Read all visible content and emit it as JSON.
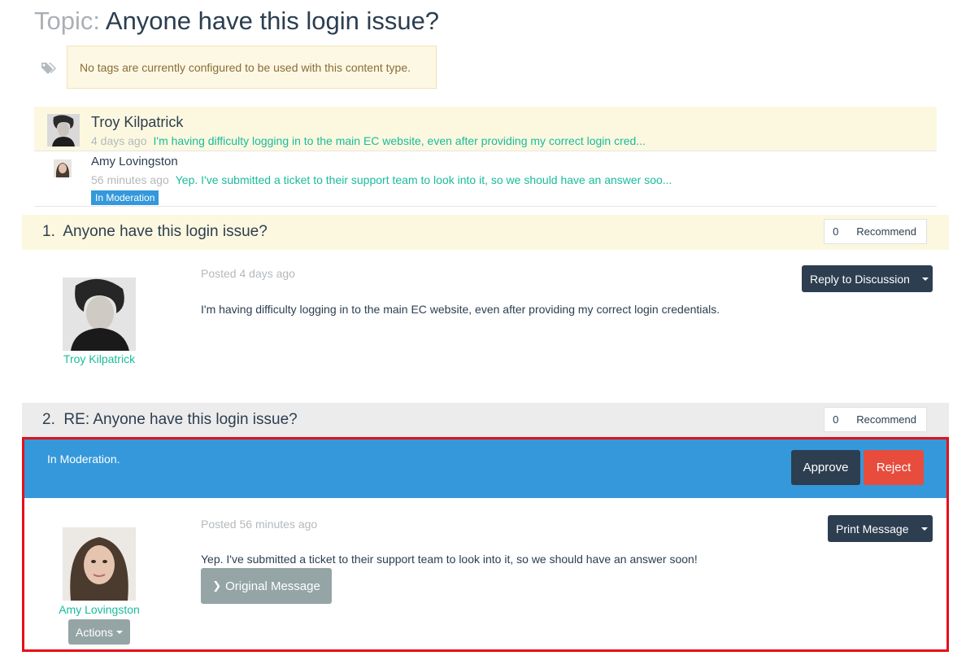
{
  "page": {
    "title_prefix": "Topic:",
    "title": "Anyone have this login issue?"
  },
  "tags": {
    "icon": "tags-icon",
    "notice": "No tags are currently configured to be used with this content type."
  },
  "thread_summary": [
    {
      "author": "Troy Kilpatrick",
      "time": "4 days ago",
      "excerpt": "I'm having difficulty logging in to the main EC website, even after providing my correct login cred..."
    },
    {
      "author": "Amy Lovingston",
      "time": "56 minutes ago",
      "excerpt": "Yep. I've submitted a ticket to their support team to look into it, so we should have an answer soo...",
      "badge": "In Moderation"
    }
  ],
  "posts": [
    {
      "number": "1.",
      "title": "Anyone have this login issue?",
      "recommend_count": "0",
      "recommend_label": "Recommend",
      "author": "Troy Kilpatrick",
      "posted": "Posted 4 days ago",
      "body": "I'm having difficulty logging in to the main EC website, even after providing my correct login credentials.",
      "action_button": "Reply to Discussion"
    },
    {
      "number": "2.",
      "title": "RE: Anyone have this login issue?",
      "recommend_count": "0",
      "recommend_label": "Recommend",
      "moderation_text": "In Moderation.",
      "approve_label": "Approve",
      "reject_label": "Reject",
      "author": "Amy Lovingston",
      "posted": "Posted 56 minutes ago",
      "body": "Yep. I've submitted a ticket to their support team to look into it, so we should have an answer soon!",
      "action_button": "Print Message",
      "original_message_label": "Original Message",
      "actions_label": "Actions"
    }
  ],
  "colors": {
    "primary": "#2c3e50",
    "accent": "#18bc9c",
    "info": "#3498db",
    "danger": "#e74c3c",
    "muted": "#95a5a6",
    "highlight_frame": "#e5101a",
    "warning_bg": "#fcf8e3"
  }
}
